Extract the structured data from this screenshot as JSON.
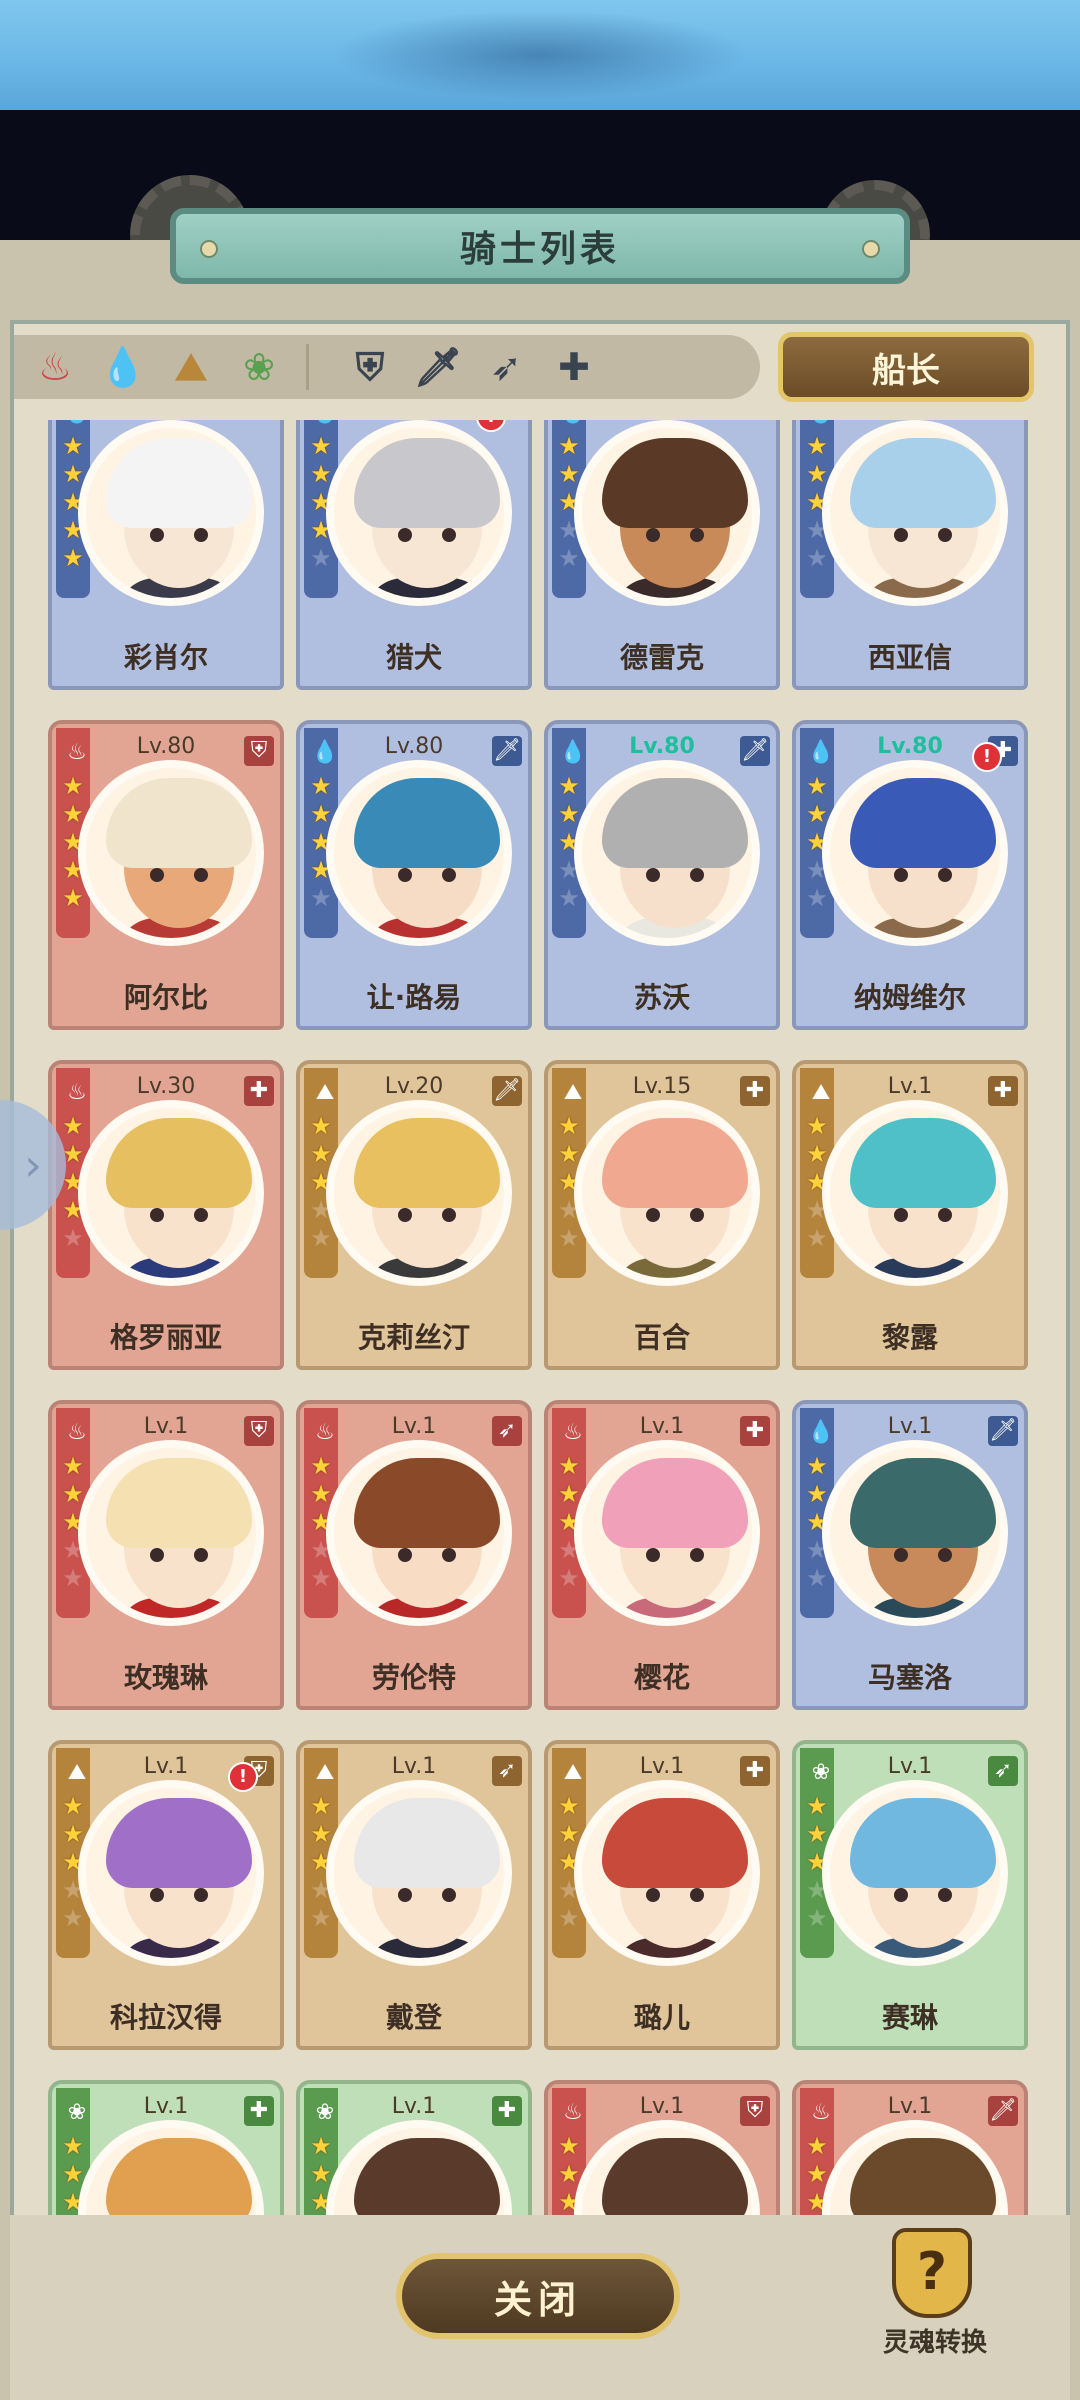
{
  "header": {
    "title": "骑士列表"
  },
  "filters": {
    "elements": [
      {
        "icon": "fire-element-icon",
        "glyph": "♨",
        "color": "#c84a4a"
      },
      {
        "icon": "water-element-icon",
        "glyph": "💧",
        "color": "#4d6fb5"
      },
      {
        "icon": "earth-element-icon",
        "glyph": "⛰",
        "color": "#b8873a"
      },
      {
        "icon": "wind-element-icon",
        "glyph": "❀",
        "color": "#5aa050"
      }
    ],
    "classes": [
      {
        "icon": "shield-class-icon",
        "glyph": "⛨"
      },
      {
        "icon": "sword-class-icon",
        "glyph": "🗡"
      },
      {
        "icon": "bow-class-icon",
        "glyph": "➶"
      },
      {
        "icon": "healer-class-icon",
        "glyph": "✚"
      }
    ],
    "captain_label": "船长"
  },
  "knights": [
    {
      "name": "彩肖尔",
      "element": "water",
      "level": "",
      "stars": 5,
      "class_glyph": "",
      "hair": "#f4f4f4",
      "skin": "#f8e6d4",
      "outfit": "#3a3a4a",
      "badge": false
    },
    {
      "name": "猎犬",
      "element": "water",
      "level": "",
      "stars": 4,
      "class_glyph": "",
      "hair": "#c8c8cc",
      "skin": "#f8e6d4",
      "outfit": "#2a2a3a",
      "badge": true
    },
    {
      "name": "德雷克",
      "element": "water",
      "level": "",
      "stars": 3,
      "class_glyph": "",
      "hair": "#5a3a26",
      "skin": "#c98a5a",
      "outfit": "#3a2a2a",
      "badge": false
    },
    {
      "name": "西亚信",
      "element": "water",
      "level": "",
      "stars": 3,
      "class_glyph": "",
      "hair": "#a8d0ea",
      "skin": "#f8e6d4",
      "outfit": "#8a6a4a",
      "badge": false
    },
    {
      "name": "阿尔比",
      "element": "fire",
      "level": "Lv.80",
      "level_teal": false,
      "stars": 5,
      "class_glyph": "⛨",
      "hair": "#f0e4cc",
      "skin": "#e8a87a",
      "outfit": "#b83a34",
      "badge": false
    },
    {
      "name": "让·路易",
      "element": "water",
      "level": "Lv.80",
      "level_teal": false,
      "stars": 4,
      "class_glyph": "🗡",
      "hair": "#3a8ab8",
      "skin": "#f6dcc4",
      "outfit": "#b83030",
      "badge": false
    },
    {
      "name": "苏沃",
      "element": "water",
      "level": "Lv.80",
      "level_teal": true,
      "stars": 3,
      "class_glyph": "🗡",
      "hair": "#b0b0b0",
      "skin": "#f6e0cc",
      "outfit": "#e8e8e0",
      "badge": false
    },
    {
      "name": "纳姆维尔",
      "element": "water",
      "level": "Lv.80",
      "level_teal": true,
      "stars": 3,
      "class_glyph": "✚",
      "hair": "#3a5ab8",
      "skin": "#f6e0cc",
      "outfit": "#8a6a4a",
      "badge": true
    },
    {
      "name": "格罗丽亚",
      "element": "fire",
      "level": "Lv.30",
      "level_teal": false,
      "stars": 4,
      "class_glyph": "✚",
      "hair": "#e6c060",
      "skin": "#f8e2cc",
      "outfit": "#2a3a7a",
      "badge": false
    },
    {
      "name": "克莉丝汀",
      "element": "earth",
      "level": "Lv.20",
      "level_teal": false,
      "stars": 3,
      "class_glyph": "🗡",
      "hair": "#e8c060",
      "skin": "#f8e2cc",
      "outfit": "#3a3a3a",
      "badge": false
    },
    {
      "name": "百合",
      "element": "earth",
      "level": "Lv.15",
      "level_teal": false,
      "stars": 3,
      "class_glyph": "✚",
      "hair": "#f0a890",
      "skin": "#f8e2cc",
      "outfit": "#7a6a3a",
      "badge": false
    },
    {
      "name": "黎露",
      "element": "earth",
      "level": "Lv.1",
      "level_teal": false,
      "stars": 3,
      "class_glyph": "✚",
      "hair": "#50c0c8",
      "skin": "#f8e2cc",
      "outfit": "#2a3a5a",
      "badge": false
    },
    {
      "name": "玫瑰琳",
      "element": "fire",
      "level": "Lv.1",
      "level_teal": false,
      "stars": 3,
      "class_glyph": "⛨",
      "hair": "#f4e0b0",
      "skin": "#f8e2cc",
      "outfit": "#c02828",
      "badge": false
    },
    {
      "name": "劳伦特",
      "element": "fire",
      "level": "Lv.1",
      "level_teal": false,
      "stars": 3,
      "class_glyph": "➶",
      "hair": "#8a4a2a",
      "skin": "#f8dcc4",
      "outfit": "#b82828",
      "badge": false
    },
    {
      "name": "樱花",
      "element": "fire",
      "level": "Lv.1",
      "level_teal": false,
      "stars": 3,
      "class_glyph": "✚",
      "hair": "#f0a0b8",
      "skin": "#f8e2cc",
      "outfit": "#c86a7a",
      "badge": false
    },
    {
      "name": "马塞洛",
      "element": "water",
      "level": "Lv.1",
      "level_teal": false,
      "stars": 3,
      "class_glyph": "🗡",
      "hair": "#3a6a6a",
      "skin": "#c88a5a",
      "outfit": "#2a4a5a",
      "badge": false
    },
    {
      "name": "科拉汉得",
      "element": "earth",
      "level": "Lv.1",
      "level_teal": false,
      "stars": 3,
      "class_glyph": "⛨",
      "hair": "#a070c8",
      "skin": "#f8e2cc",
      "outfit": "#3a2a4a",
      "badge": true
    },
    {
      "name": "戴登",
      "element": "earth",
      "level": "Lv.1",
      "level_teal": false,
      "stars": 3,
      "class_glyph": "➶",
      "hair": "#e8e8e8",
      "skin": "#f8e2cc",
      "outfit": "#2a2a3a",
      "badge": false
    },
    {
      "name": "璐儿",
      "element": "earth",
      "level": "Lv.1",
      "level_teal": false,
      "stars": 3,
      "class_glyph": "✚",
      "hair": "#c84a3a",
      "skin": "#f8e2cc",
      "outfit": "#4a2a2a",
      "badge": false
    },
    {
      "name": "赛琳",
      "element": "wind",
      "level": "Lv.1",
      "level_teal": false,
      "stars": 3,
      "class_glyph": "➶",
      "hair": "#70b8e0",
      "skin": "#f8e2cc",
      "outfit": "#3a5a7a",
      "badge": false
    },
    {
      "name": "",
      "element": "wind",
      "level": "Lv.1",
      "level_teal": false,
      "stars": 3,
      "class_glyph": "✚",
      "hair": "#e0a050",
      "skin": "#f8e2cc",
      "outfit": "#3a5aa0",
      "badge": false
    },
    {
      "name": "",
      "element": "wind",
      "level": "Lv.1",
      "level_teal": false,
      "stars": 3,
      "class_glyph": "✚",
      "hair": "#5a3a2a",
      "skin": "#f8e2cc",
      "outfit": "#4a4a4a",
      "badge": false
    },
    {
      "name": "",
      "element": "fire",
      "level": "Lv.1",
      "level_teal": false,
      "stars": 3,
      "class_glyph": "⛨",
      "hair": "#5a3a2a",
      "skin": "#e8b08a",
      "outfit": "#5a3a2a",
      "badge": false
    },
    {
      "name": "",
      "element": "fire",
      "level": "Lv.1",
      "level_teal": false,
      "stars": 3,
      "class_glyph": "🗡",
      "hair": "#6a4a2a",
      "skin": "#f0c8a8",
      "outfit": "#5a3a2a",
      "badge": false
    }
  ],
  "element_glyphs": {
    "fire": "♨",
    "water": "💧",
    "earth": "⛰",
    "wind": "❀"
  },
  "footer": {
    "close_label": "关闭",
    "soul_label": "灵魂转换",
    "soul_glyph": "?"
  },
  "side_tab": {
    "glyph": "›"
  }
}
